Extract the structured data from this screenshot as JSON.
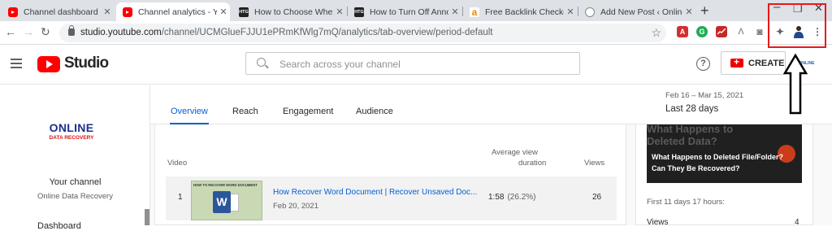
{
  "browser": {
    "tabs": [
      {
        "title": "Channel dashboard - Yo",
        "favicon": "youtube-icon"
      },
      {
        "title": "Channel analytics - You",
        "favicon": "youtube-icon"
      },
      {
        "title": "How to Choose When W",
        "favicon": "htg-icon"
      },
      {
        "title": "How to Turn Off Annoy",
        "favicon": "htg-icon"
      },
      {
        "title": "Free Backlink Checker b",
        "favicon": "amazon-a-icon"
      },
      {
        "title": "Add New Post ‹ Online",
        "favicon": "wordpress-icon"
      }
    ],
    "url_host": "studio.youtube.com",
    "url_path": "/channel/UCMGlueFJJU1ePRmKfWlg7mQ/analytics/tab-overview/period-default",
    "fav_htg": "HTG",
    "fav_amz": "a",
    "ext_pdf": "A",
    "ext_g": "G"
  },
  "header": {
    "studio_label": "Studio",
    "search_placeholder": "Search across your channel",
    "help": "?",
    "create_label": "CREATE",
    "avatar_text": "ONLINE"
  },
  "sidebar": {
    "logo_line1": "ONLINE",
    "logo_line2": "DATA RECOVERY",
    "your_channel": "Your channel",
    "channel_name": "Online Data Recovery",
    "first_item": "Dashboard"
  },
  "analytics": {
    "tabs": [
      "Overview",
      "Reach",
      "Engagement",
      "Audience"
    ],
    "date_range": "Feb 16 – Mar 15, 2021",
    "period": "Last 28 days",
    "table": {
      "col_video": "Video",
      "col_avd_1": "Average view",
      "col_avd_2": "duration",
      "col_views": "Views",
      "rows": [
        {
          "rank": "1",
          "thumb_text": "HOW TO RECOVER WORD DOCUMENT",
          "thumb_icon": "W",
          "title": "How Recover Word Document | Recover Unsaved Doc...",
          "date": "Feb 20, 2021",
          "duration": "1:58",
          "percent": "(26.2%)",
          "views": "26"
        }
      ]
    },
    "promo": {
      "bg_line1": "What Happens to",
      "bg_line2": "Deleted Data?",
      "fg_line1": "What Happens to Deleted File/Folder?",
      "fg_line2": "Can They Be Recovered?"
    },
    "first_hours": "First 11 days 17 hours:",
    "views_label": "Views",
    "views_value": "4"
  },
  "colors": {
    "highlight": "#e8191c",
    "youtube_red": "#ff0000",
    "link_blue": "#065fd4"
  }
}
